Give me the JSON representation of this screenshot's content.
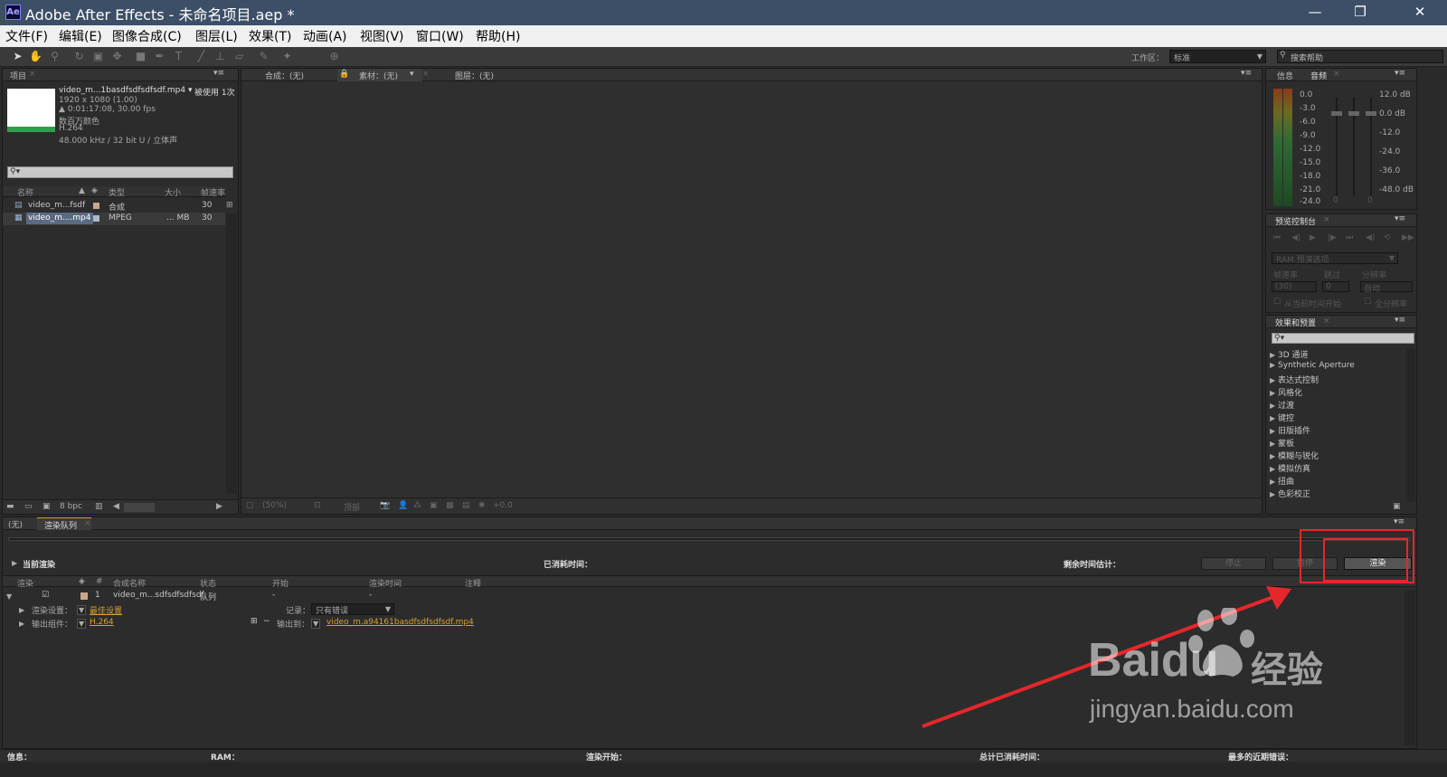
{
  "window": {
    "title": "Adobe After Effects - 未命名项目.aep *",
    "logo_text": "Ae",
    "controls": {
      "minimize": "—",
      "restore": "❐",
      "close": "✕"
    }
  },
  "menu": [
    "文件(F)",
    "编辑(E)",
    "图像合成(C)",
    "图层(L)",
    "效果(T)",
    "动画(A)",
    "视图(V)",
    "窗口(W)",
    "帮助(H)"
  ],
  "toolbar": {
    "workspace_label": "工作区：",
    "workspace_value": "标准",
    "search_placeholder": "搜索帮助"
  },
  "project_panel": {
    "tab": "项目",
    "file_name": "video_m...1basdfsdfsdfsdf.mp4 ▾",
    "used_count": "被使用 1次",
    "resolution": "1920 x 1080 (1.00)",
    "duration": "▲ 0:01:17:08, 30.00 fps",
    "colors": "数百万颜色",
    "codec": "H.264",
    "audio": "48.000 kHz / 32 bit U / 立体声",
    "columns": [
      "名称",
      "类型",
      "大小",
      "帧速率"
    ],
    "items": [
      {
        "name": "video_m...fsdf",
        "type": "合成",
        "size": "",
        "fps": "30",
        "label_color": "#c9a88a"
      },
      {
        "name": "video_m....mp4",
        "type": "MPEG",
        "size": "... MB",
        "fps": "30",
        "label_color": "#b0b8c8"
      }
    ],
    "bpc": "8 bpc"
  },
  "viewer": {
    "tabs": [
      "合成：(无)",
      "素材：(无)",
      "图层：(无)"
    ],
    "zoom": "(50%)",
    "view_label": "顶部",
    "exposure": "+0.0"
  },
  "info_panel": {
    "tabs": [
      "信息",
      "音频"
    ],
    "levels_left": [
      "0.0",
      "-3.0",
      "-6.0",
      "-9.0",
      "-12.0",
      "-15.0",
      "-18.0",
      "-21.0",
      "-24.0"
    ],
    "levels_right": [
      "12.0 dB",
      "0.0 dB",
      "-12.0",
      "-24.0",
      "-36.0",
      "-48.0 dB"
    ],
    "slider_zeros": [
      "0",
      "0"
    ]
  },
  "preview_panel": {
    "tab": "预览控制台",
    "ram_label": "RAM 预演选项",
    "fps_label": "帧速率",
    "skip_label": "跳过",
    "resolution_label": "分辨率",
    "fps_value": "(30)",
    "skip_value": "0",
    "resolution_value": "自动",
    "from_current": "从当前时间开始",
    "fullscreen": "全分辨率"
  },
  "effects_panel": {
    "tab": "效果和预置",
    "items": [
      "3D 通道",
      "Synthetic Aperture",
      "表达式控制",
      "风格化",
      "过渡",
      "键控",
      "旧版插件",
      "蒙板",
      "模糊与锐化",
      "模拟仿真",
      "扭曲",
      "色彩校正"
    ]
  },
  "render_queue": {
    "tabs": [
      "(无)",
      "渲染队列"
    ],
    "current_render": "当前渲染",
    "elapsed": "已消耗时间：",
    "remaining": "剩余时间估计：",
    "stop_label": "停止",
    "pause_label": "暂停",
    "render_label": "渲染",
    "columns": [
      "渲染",
      "#",
      "合成名称",
      "状态",
      "开始",
      "渲染时间",
      "注释"
    ],
    "item": {
      "number": "1",
      "comp": "video_m...sdfsdfsdfsdf",
      "status": "队列",
      "start": "-",
      "render_time": "-"
    },
    "render_settings_label": "渲染设置：",
    "render_settings_value": "最佳设置",
    "log_label": "记录：",
    "log_value": "只有错误",
    "output_module_label": "输出组件：",
    "output_module_value": "H.264",
    "output_to_label": "输出到：",
    "output_to_value": "video_m.a94161basdfsdfsdfsdf.mp4",
    "status_bar": [
      "信息：",
      "RAM：",
      "渲染开始：",
      "总计已消耗时间：",
      "最多的近期错误："
    ]
  },
  "watermark": {
    "brand": "Baidu",
    "site_suffix": "经验",
    "url": "jingyan.baidu.com"
  },
  "colors": {
    "title_bar": "#3c4f66",
    "highlight": "#e5272b",
    "accent_orange": "#d6a12e"
  }
}
